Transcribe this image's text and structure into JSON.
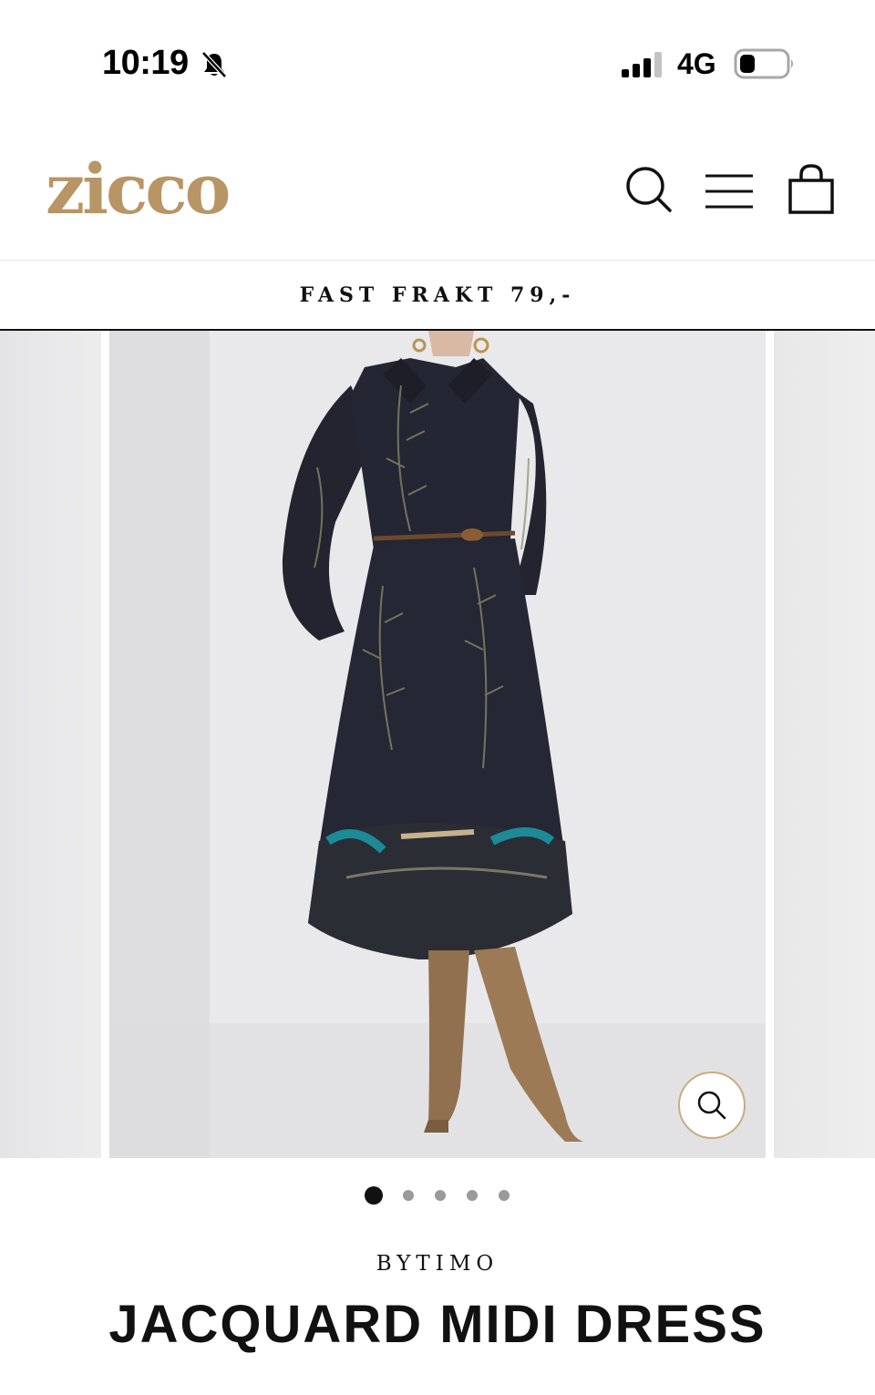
{
  "status_bar": {
    "time": "10:19",
    "network": "4G",
    "icons": [
      "bell-off-icon",
      "signal-icon",
      "battery-icon"
    ]
  },
  "header": {
    "logo": "zicco",
    "icons": [
      "search-icon",
      "menu-icon",
      "cart-icon"
    ]
  },
  "announcement": {
    "text": "FAST FRAKT 79,-"
  },
  "gallery": {
    "slide_count": 5,
    "active_slide": 1,
    "zoom_icon": "zoom-icon"
  },
  "product": {
    "vendor": "BYTIMO",
    "title": "JACQUARD MIDI DRESS"
  },
  "colors": {
    "brand": "#b89565",
    "text": "#111111",
    "dot_inactive": "#9a9a9a",
    "zoom_border": "#c9ab80"
  }
}
